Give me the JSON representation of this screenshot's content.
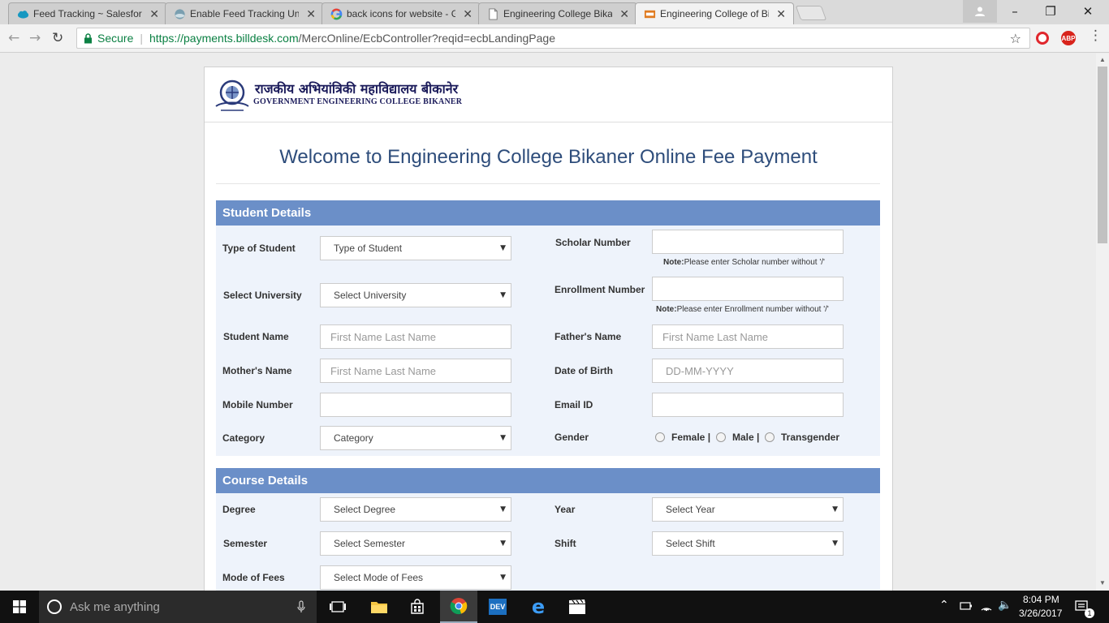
{
  "browser": {
    "tabs": [
      {
        "title": "Feed Tracking ~ Salesforce"
      },
      {
        "title": "Enable Feed Tracking Un"
      },
      {
        "title": "back icons for website - G"
      },
      {
        "title": "Engineering College Bikan"
      },
      {
        "title": "Engineering College of Bi"
      }
    ],
    "secure_label": "Secure",
    "url_scheme_host": "https://payments.billdesk.com",
    "url_path": "/MercOnline/EcbController?reqid=ecbLandingPage",
    "ext_abp": "ABP"
  },
  "header": {
    "hindi_name": "राजकीय अभियांत्रिकी महाविद्यालय बीकानेर",
    "english_name": "GOVERNMENT ENGINEERING COLLEGE BIKANER"
  },
  "welcome": "Welcome to Engineering College Bikaner Online Fee Payment",
  "student_details": {
    "heading": "Student Details",
    "type_of_student": {
      "label": "Type of Student",
      "value": "Type of Student"
    },
    "scholar_number": {
      "label": "Scholar Number",
      "note_bold": "Note:",
      "note": "Please enter Scholar number without '/'"
    },
    "select_university": {
      "label": "Select University",
      "value": "Select University"
    },
    "enrollment_number": {
      "label": "Enrollment Number",
      "note_bold": "Note:",
      "note": "Please enter Enrollment number without '/'"
    },
    "student_name": {
      "label": "Student Name",
      "placeholder": "First Name Last Name"
    },
    "fathers_name": {
      "label": "Father's Name",
      "placeholder": "First Name Last Name"
    },
    "mothers_name": {
      "label": "Mother's Name",
      "placeholder": "First Name Last Name"
    },
    "dob": {
      "label": "Date of Birth",
      "placeholder": "DD-MM-YYYY"
    },
    "mobile": {
      "label": "Mobile Number"
    },
    "email": {
      "label": "Email ID"
    },
    "category": {
      "label": "Category",
      "value": "Category"
    },
    "gender": {
      "label": "Gender",
      "options": [
        "Female |",
        "Male |",
        "Transgender"
      ]
    }
  },
  "course_details": {
    "heading": "Course Details",
    "degree": {
      "label": "Degree",
      "value": "Select Degree"
    },
    "year": {
      "label": "Year",
      "value": "Select Year"
    },
    "semester": {
      "label": "Semester",
      "value": "Select Semester"
    },
    "shift": {
      "label": "Shift",
      "value": "Select Shift"
    },
    "mode_of_fees": {
      "label": "Mode of Fees",
      "value": "Select Mode of Fees"
    }
  },
  "taskbar": {
    "search_placeholder": "Ask me anything",
    "time": "8:04 PM",
    "date": "3/26/2017",
    "dev_label": "DEV",
    "notification_count": "1"
  },
  "colors": {
    "section_header": "#6b8fc8",
    "section_bg": "#eef3fb",
    "welcome_text": "#2e4d7b",
    "secure_green": "#0b8043"
  }
}
